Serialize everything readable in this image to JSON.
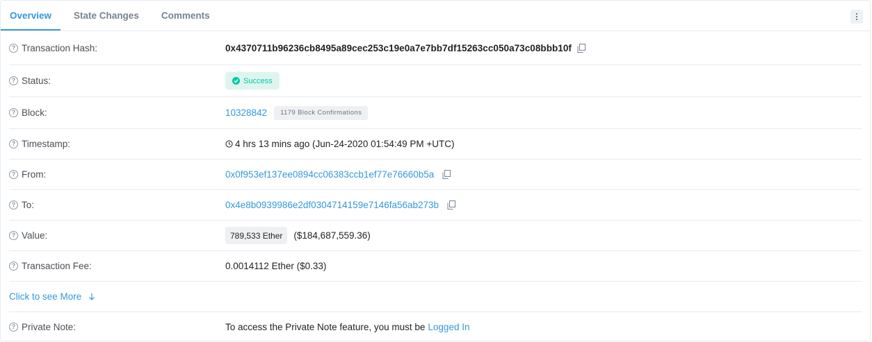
{
  "tabs": [
    "Overview",
    "State Changes",
    "Comments"
  ],
  "rows": {
    "tx_hash": {
      "label": "Transaction Hash:",
      "value": "0x4370711b96236cb8495a89cec253c19e0a7e7bb7df15263cc050a73c08bbb10f"
    },
    "status": {
      "label": "Status:",
      "value": "Success"
    },
    "block": {
      "label": "Block:",
      "value": "10328842",
      "confirmations": "1179 Block Confirmations"
    },
    "timestamp": {
      "label": "Timestamp:",
      "value": "4 hrs 13 mins ago (Jun-24-2020 01:54:49 PM +UTC)"
    },
    "from": {
      "label": "From:",
      "value": "0x0f953ef137ee0894cc06383ccb1ef77e76660b5a"
    },
    "to": {
      "label": "To:",
      "value": "0x4e8b0939986e2df0304714159e7146fa56ab273b"
    },
    "value": {
      "label": "Value:",
      "ether": "789,533 Ether",
      "usd": "($184,687,559.36)"
    },
    "fee": {
      "label": "Transaction Fee:",
      "value": "0.0014112 Ether ($0.33)"
    },
    "see_more": "Click to see More",
    "private_note": {
      "label": "Private Note:",
      "text": "To access the Private Note feature, you must be",
      "link": "Logged In"
    }
  },
  "colors": {
    "accent": "#3498db",
    "success": "#00c9a7",
    "success_bg": "#ddf5ee"
  }
}
